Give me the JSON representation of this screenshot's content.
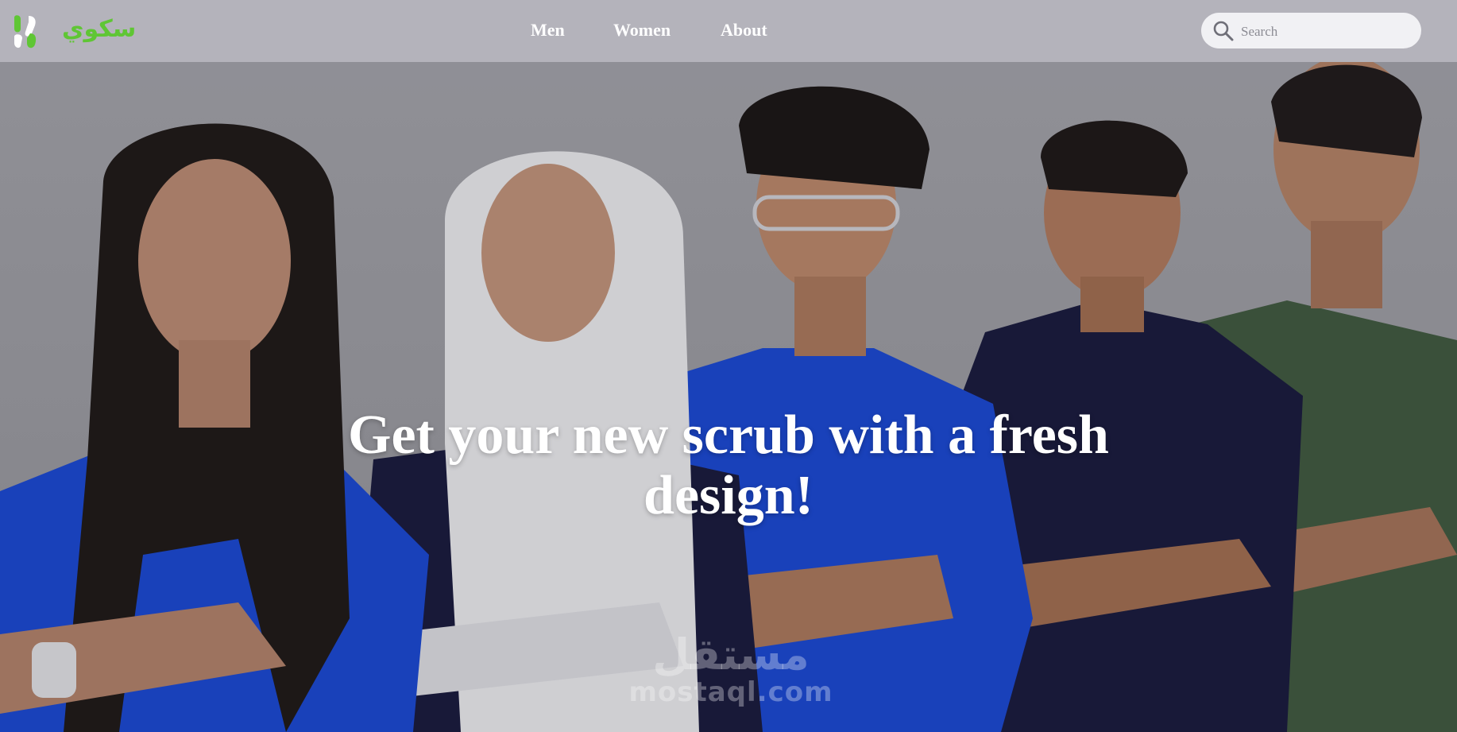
{
  "header": {
    "logo_word": "سكوي",
    "nav": {
      "men_label": "Men",
      "women_label": "Women",
      "about_label": "About"
    },
    "search": {
      "placeholder": "Search",
      "icon": "search-icon"
    }
  },
  "hero": {
    "headline": "Get your new scrub with a fresh design!",
    "watermark_glyph": "مستقل",
    "watermark_text": "mostaql.com"
  },
  "colors": {
    "header_bg": "#b4b3bb",
    "brand_green": "#5fc634",
    "scrub_royal_blue": "#1747d8",
    "scrub_navy": "#15163a",
    "scrub_olive": "#3f5a3c"
  }
}
